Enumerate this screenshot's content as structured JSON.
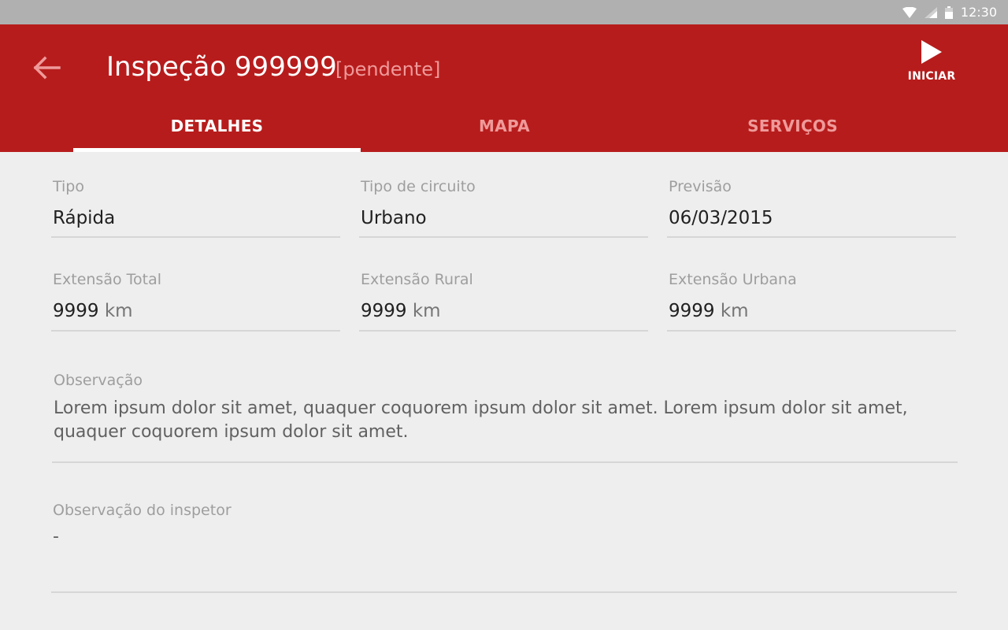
{
  "status_bar": {
    "time": "12:30",
    "icons": [
      "wifi-icon",
      "signal-icon",
      "battery-icon"
    ]
  },
  "app_bar": {
    "back_icon": "arrow-left-icon",
    "title": "Inspeção 999999",
    "status": "[pendente]",
    "start_action": {
      "icon": "play-icon",
      "label": "INICIAR"
    },
    "colors": {
      "primary": "#b71c1c",
      "on_primary": "#ffffff",
      "muted": "#ef9a9a"
    }
  },
  "tabs": [
    {
      "label": "DETALHES",
      "active": true
    },
    {
      "label": "MAPA",
      "active": false
    },
    {
      "label": "SERVIÇOS",
      "active": false
    }
  ],
  "details": {
    "tipo": {
      "label": "Tipo",
      "value": "Rápida"
    },
    "tipo_circuito": {
      "label": "Tipo de  circuito",
      "value": "Urbano"
    },
    "previsao": {
      "label": "Previsão",
      "value": "06/03/2015"
    },
    "extensao_total": {
      "label": "Extensão Total",
      "value": "9999",
      "unit": "km"
    },
    "extensao_rural": {
      "label": "Extensão Rural",
      "value": "9999",
      "unit": "km"
    },
    "extensao_urbana": {
      "label": "Extensão Urbana",
      "value": "9999",
      "unit": "km"
    },
    "observacao": {
      "label": "Observação",
      "value": "Lorem ipsum dolor sit amet, quaquer coquorem ipsum dolor sit amet. Lorem ipsum dolor sit amet, quaquer coquorem ipsum dolor sit amet."
    },
    "observacao_inspetor": {
      "label": "Observação do inspetor",
      "value": "-"
    }
  }
}
